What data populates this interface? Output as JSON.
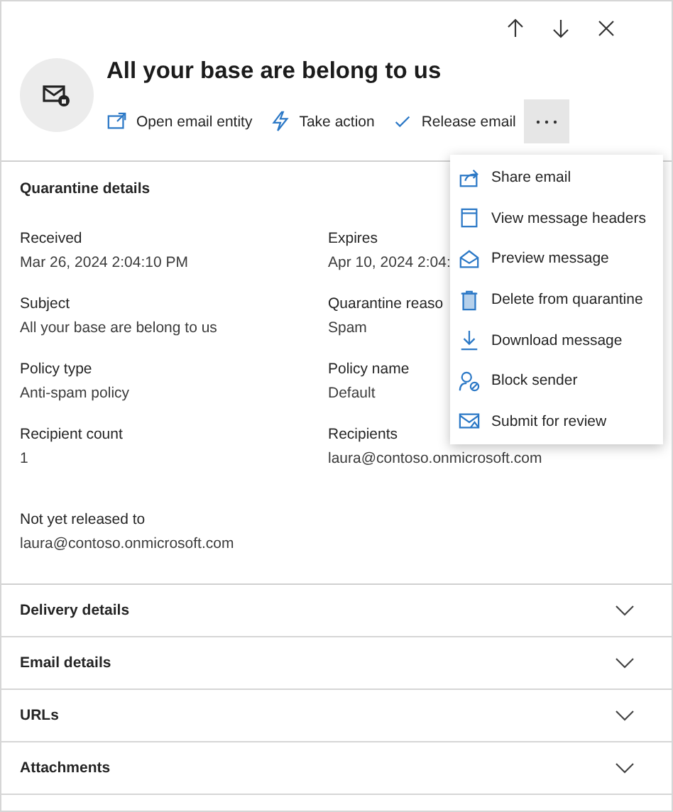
{
  "panel": {
    "title": "All your base are belong to us"
  },
  "nav_buttons": [
    {
      "kind": "up"
    },
    {
      "kind": "down"
    },
    {
      "kind": "close"
    }
  ],
  "actions": [
    {
      "kind": "open",
      "label": "Open email entity"
    },
    {
      "kind": "action",
      "label": "Take action"
    },
    {
      "kind": "release",
      "label": "Release email"
    }
  ],
  "more_button": {
    "selected": true
  },
  "section": {
    "title": "Quarantine details"
  },
  "details": [
    {
      "label": "Received",
      "value": "Mar 26, 2024 2:04:10 PM"
    },
    {
      "label": "Expires",
      "value": "Apr 10, 2024 2:04:"
    },
    {
      "label": "Subject",
      "value": "All your base are belong to us"
    },
    {
      "label": "Quarantine reaso",
      "value": "Spam"
    },
    {
      "label": "Policy type",
      "value": "Anti-spam policy"
    },
    {
      "label": "Policy name",
      "value": "Default"
    },
    {
      "label": "Recipient count",
      "value": "1"
    },
    {
      "label": "Recipients",
      "value": "laura@contoso.onmicrosoft.com"
    }
  ],
  "release_status": {
    "label": "Not yet released to",
    "value": "laura@contoso.onmicrosoft.com"
  },
  "accordions": [
    {
      "title": "Delivery details",
      "expanded": false
    },
    {
      "title": "Email details",
      "expanded": false
    },
    {
      "title": "URLs",
      "expanded": false
    },
    {
      "title": "Attachments",
      "expanded": false
    }
  ],
  "menu": [
    {
      "kind": "share",
      "label": "Share email"
    },
    {
      "kind": "headers",
      "label": "View message headers"
    },
    {
      "kind": "preview",
      "label": "Preview message"
    },
    {
      "kind": "delete",
      "label": "Delete from quarantine"
    },
    {
      "kind": "download",
      "label": "Download message"
    },
    {
      "kind": "block",
      "label": "Block sender"
    },
    {
      "kind": "submit",
      "label": "Submit for review"
    }
  ]
}
